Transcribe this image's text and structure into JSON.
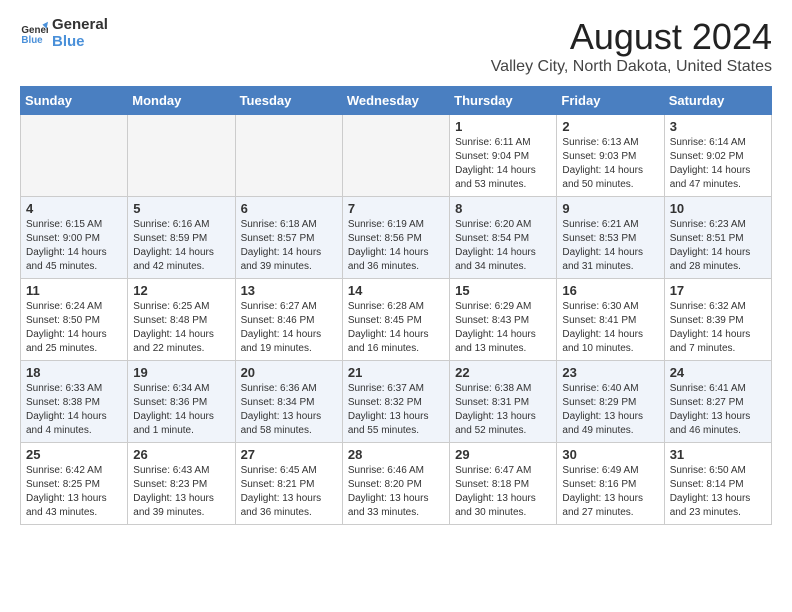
{
  "logo": {
    "line1": "General",
    "line2": "Blue"
  },
  "title": "August 2024",
  "location": "Valley City, North Dakota, United States",
  "weekdays": [
    "Sunday",
    "Monday",
    "Tuesday",
    "Wednesday",
    "Thursday",
    "Friday",
    "Saturday"
  ],
  "weeks": [
    [
      {
        "day": "",
        "info": ""
      },
      {
        "day": "",
        "info": ""
      },
      {
        "day": "",
        "info": ""
      },
      {
        "day": "",
        "info": ""
      },
      {
        "day": "1",
        "info": "Sunrise: 6:11 AM\nSunset: 9:04 PM\nDaylight: 14 hours\nand 53 minutes."
      },
      {
        "day": "2",
        "info": "Sunrise: 6:13 AM\nSunset: 9:03 PM\nDaylight: 14 hours\nand 50 minutes."
      },
      {
        "day": "3",
        "info": "Sunrise: 6:14 AM\nSunset: 9:02 PM\nDaylight: 14 hours\nand 47 minutes."
      }
    ],
    [
      {
        "day": "4",
        "info": "Sunrise: 6:15 AM\nSunset: 9:00 PM\nDaylight: 14 hours\nand 45 minutes."
      },
      {
        "day": "5",
        "info": "Sunrise: 6:16 AM\nSunset: 8:59 PM\nDaylight: 14 hours\nand 42 minutes."
      },
      {
        "day": "6",
        "info": "Sunrise: 6:18 AM\nSunset: 8:57 PM\nDaylight: 14 hours\nand 39 minutes."
      },
      {
        "day": "7",
        "info": "Sunrise: 6:19 AM\nSunset: 8:56 PM\nDaylight: 14 hours\nand 36 minutes."
      },
      {
        "day": "8",
        "info": "Sunrise: 6:20 AM\nSunset: 8:54 PM\nDaylight: 14 hours\nand 34 minutes."
      },
      {
        "day": "9",
        "info": "Sunrise: 6:21 AM\nSunset: 8:53 PM\nDaylight: 14 hours\nand 31 minutes."
      },
      {
        "day": "10",
        "info": "Sunrise: 6:23 AM\nSunset: 8:51 PM\nDaylight: 14 hours\nand 28 minutes."
      }
    ],
    [
      {
        "day": "11",
        "info": "Sunrise: 6:24 AM\nSunset: 8:50 PM\nDaylight: 14 hours\nand 25 minutes."
      },
      {
        "day": "12",
        "info": "Sunrise: 6:25 AM\nSunset: 8:48 PM\nDaylight: 14 hours\nand 22 minutes."
      },
      {
        "day": "13",
        "info": "Sunrise: 6:27 AM\nSunset: 8:46 PM\nDaylight: 14 hours\nand 19 minutes."
      },
      {
        "day": "14",
        "info": "Sunrise: 6:28 AM\nSunset: 8:45 PM\nDaylight: 14 hours\nand 16 minutes."
      },
      {
        "day": "15",
        "info": "Sunrise: 6:29 AM\nSunset: 8:43 PM\nDaylight: 14 hours\nand 13 minutes."
      },
      {
        "day": "16",
        "info": "Sunrise: 6:30 AM\nSunset: 8:41 PM\nDaylight: 14 hours\nand 10 minutes."
      },
      {
        "day": "17",
        "info": "Sunrise: 6:32 AM\nSunset: 8:39 PM\nDaylight: 14 hours\nand 7 minutes."
      }
    ],
    [
      {
        "day": "18",
        "info": "Sunrise: 6:33 AM\nSunset: 8:38 PM\nDaylight: 14 hours\nand 4 minutes."
      },
      {
        "day": "19",
        "info": "Sunrise: 6:34 AM\nSunset: 8:36 PM\nDaylight: 14 hours\nand 1 minute."
      },
      {
        "day": "20",
        "info": "Sunrise: 6:36 AM\nSunset: 8:34 PM\nDaylight: 13 hours\nand 58 minutes."
      },
      {
        "day": "21",
        "info": "Sunrise: 6:37 AM\nSunset: 8:32 PM\nDaylight: 13 hours\nand 55 minutes."
      },
      {
        "day": "22",
        "info": "Sunrise: 6:38 AM\nSunset: 8:31 PM\nDaylight: 13 hours\nand 52 minutes."
      },
      {
        "day": "23",
        "info": "Sunrise: 6:40 AM\nSunset: 8:29 PM\nDaylight: 13 hours\nand 49 minutes."
      },
      {
        "day": "24",
        "info": "Sunrise: 6:41 AM\nSunset: 8:27 PM\nDaylight: 13 hours\nand 46 minutes."
      }
    ],
    [
      {
        "day": "25",
        "info": "Sunrise: 6:42 AM\nSunset: 8:25 PM\nDaylight: 13 hours\nand 43 minutes."
      },
      {
        "day": "26",
        "info": "Sunrise: 6:43 AM\nSunset: 8:23 PM\nDaylight: 13 hours\nand 39 minutes."
      },
      {
        "day": "27",
        "info": "Sunrise: 6:45 AM\nSunset: 8:21 PM\nDaylight: 13 hours\nand 36 minutes."
      },
      {
        "day": "28",
        "info": "Sunrise: 6:46 AM\nSunset: 8:20 PM\nDaylight: 13 hours\nand 33 minutes."
      },
      {
        "day": "29",
        "info": "Sunrise: 6:47 AM\nSunset: 8:18 PM\nDaylight: 13 hours\nand 30 minutes."
      },
      {
        "day": "30",
        "info": "Sunrise: 6:49 AM\nSunset: 8:16 PM\nDaylight: 13 hours\nand 27 minutes."
      },
      {
        "day": "31",
        "info": "Sunrise: 6:50 AM\nSunset: 8:14 PM\nDaylight: 13 hours\nand 23 minutes."
      }
    ]
  ]
}
